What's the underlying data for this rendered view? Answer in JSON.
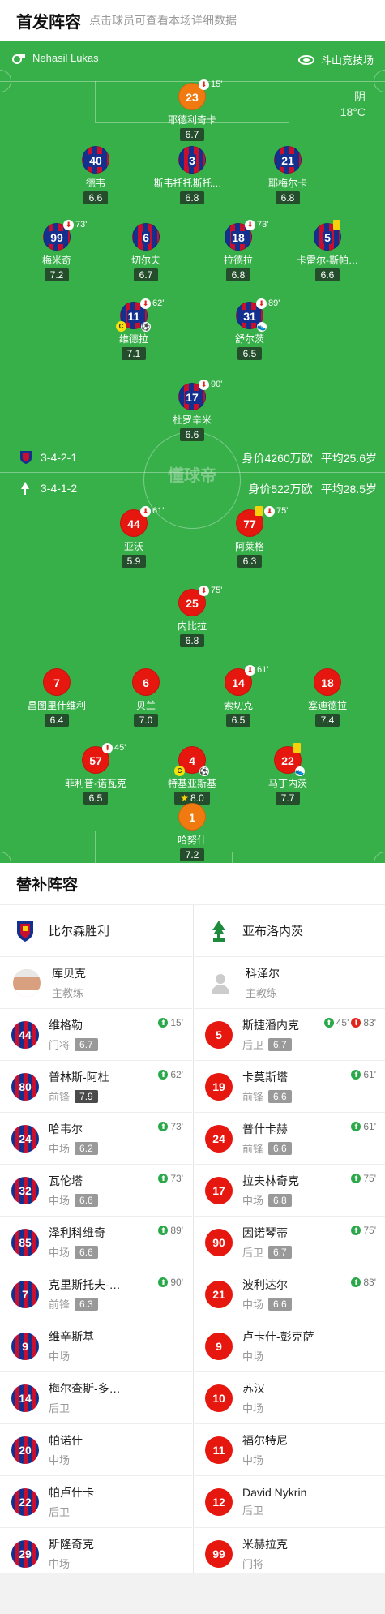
{
  "header": {
    "title": "首发阵容",
    "subtitle": "点击球员可查看本场详细数据"
  },
  "pitch": {
    "referee": "Nehasil Lukas",
    "venue": "斗山竞技场",
    "weather": "阴",
    "temperature": "18°C",
    "watermark": "懂球帝",
    "home": {
      "formation": "3-4-2-1",
      "value": "身价4260万欧",
      "age": "平均25.6岁"
    },
    "away": {
      "formation": "3-4-1-2",
      "value": "身价522万欧",
      "age": "平均28.5岁"
    }
  },
  "home_players": [
    {
      "num": "23",
      "name": "耶德利奇卡",
      "rating": "6.7",
      "sub": "15'",
      "kit": "orange"
    },
    {
      "num": "40",
      "name": "德韦",
      "rating": "6.6",
      "kit": "blue"
    },
    {
      "num": "3",
      "name": "斯韦托托斯托托斯托托…",
      "rating": "6.8",
      "kit": "blue"
    },
    {
      "num": "21",
      "name": "耶梅尔卡",
      "rating": "6.8",
      "kit": "blue"
    },
    {
      "num": "99",
      "name": "梅米奇",
      "rating": "7.2",
      "sub": "73'",
      "kit": "blue"
    },
    {
      "num": "6",
      "name": "切尔夫",
      "rating": "6.7",
      "kit": "blue"
    },
    {
      "num": "18",
      "name": "拉德拉",
      "rating": "6.8",
      "sub": "73'",
      "kit": "blue"
    },
    {
      "num": "5",
      "name": "卡雷尔-斯帕…",
      "rating": "6.6",
      "kit": "blue"
    },
    {
      "num": "11",
      "name": "维德拉",
      "rating": "7.1",
      "sub": "62'",
      "kit": "blue"
    },
    {
      "num": "31",
      "name": "舒尔茨",
      "rating": "6.5",
      "sub": "89'",
      "kit": "blue"
    },
    {
      "num": "17",
      "name": "杜罗辛米",
      "rating": "6.6",
      "sub": "90'",
      "kit": "blue"
    }
  ],
  "away_players": [
    {
      "num": "44",
      "name": "亚沃",
      "rating": "5.9",
      "sub": "61'",
      "kit": "red"
    },
    {
      "num": "77",
      "name": "阿莱格",
      "rating": "6.3",
      "sub": "75'",
      "kit": "red"
    },
    {
      "num": "25",
      "name": "内比拉",
      "rating": "6.8",
      "sub": "75'",
      "kit": "red"
    },
    {
      "num": "7",
      "name": "昌图里什维利",
      "rating": "6.4",
      "kit": "red"
    },
    {
      "num": "6",
      "name": "贝兰",
      "rating": "7.0",
      "kit": "red"
    },
    {
      "num": "14",
      "name": "索切克",
      "rating": "6.5",
      "sub": "61'",
      "kit": "red"
    },
    {
      "num": "18",
      "name": "塞迪德拉",
      "rating": "7.4",
      "kit": "red"
    },
    {
      "num": "57",
      "name": "菲利普-诺瓦克",
      "rating": "6.5",
      "sub": "45'",
      "kit": "red"
    },
    {
      "num": "4",
      "name": "特基亚斯基",
      "rating": "8.0",
      "kit": "red"
    },
    {
      "num": "22",
      "name": "马丁内茨",
      "rating": "7.7",
      "kit": "red"
    },
    {
      "num": "1",
      "name": "哈努什",
      "rating": "7.2",
      "kit": "orange"
    }
  ],
  "bench_section": {
    "title": "替补阵容"
  },
  "home_bench": {
    "team": "比尔森胜利",
    "coach": {
      "name": "库贝克",
      "role": "主教练"
    },
    "players": [
      {
        "num": "44",
        "name": "维格勒",
        "pos": "门将",
        "rating": "6.7",
        "in": "15'"
      },
      {
        "num": "80",
        "name": "普林斯-阿杜",
        "pos": "前锋",
        "rating": "7.9",
        "in": "62'"
      },
      {
        "num": "24",
        "name": "哈韦尔",
        "pos": "中场",
        "rating": "6.2",
        "in": "73'"
      },
      {
        "num": "32",
        "name": "瓦伦塔",
        "pos": "中场",
        "rating": "6.6",
        "in": "73'"
      },
      {
        "num": "85",
        "name": "泽利科维奇",
        "pos": "中场",
        "rating": "6.6",
        "in": "89'"
      },
      {
        "num": "7",
        "name": "克里斯托夫-…",
        "pos": "前锋",
        "rating": "6.3",
        "in": "90'"
      },
      {
        "num": "9",
        "name": "维辛斯基",
        "pos": "中场"
      },
      {
        "num": "14",
        "name": "梅尔查斯-多…",
        "pos": "后卫"
      },
      {
        "num": "20",
        "name": "帕诺什",
        "pos": "中场"
      },
      {
        "num": "22",
        "name": "帕卢什卡",
        "pos": "后卫"
      },
      {
        "num": "29",
        "name": "斯隆奇克",
        "pos": "中场"
      }
    ]
  },
  "away_bench": {
    "team": "亚布洛内茨",
    "coach": {
      "name": "科泽尔",
      "role": "主教练"
    },
    "players": [
      {
        "num": "5",
        "name": "斯捷潘内克",
        "pos": "后卫",
        "rating": "6.7",
        "in": "45'",
        "out": "83'"
      },
      {
        "num": "19",
        "name": "卡莫斯塔",
        "pos": "前锋",
        "rating": "6.6",
        "in": "61'"
      },
      {
        "num": "24",
        "name": "普什卡赫",
        "pos": "前锋",
        "rating": "6.6",
        "in": "61'"
      },
      {
        "num": "17",
        "name": "拉夫林奇克",
        "pos": "中场",
        "rating": "6.8",
        "in": "75'"
      },
      {
        "num": "90",
        "name": "因诺琴蒂",
        "pos": "后卫",
        "rating": "6.7",
        "in": "75'"
      },
      {
        "num": "21",
        "name": "波利达尔",
        "pos": "中场",
        "rating": "6.6",
        "in": "83'"
      },
      {
        "num": "9",
        "name": "卢卡什-彭克萨",
        "pos": "中场"
      },
      {
        "num": "10",
        "name": "苏汉",
        "pos": "中场"
      },
      {
        "num": "11",
        "name": "福尔特尼",
        "pos": "中场"
      },
      {
        "num": "12",
        "name": "David Nykrin",
        "pos": "后卫"
      },
      {
        "num": "99",
        "name": "米赫拉克",
        "pos": "门将"
      }
    ]
  }
}
